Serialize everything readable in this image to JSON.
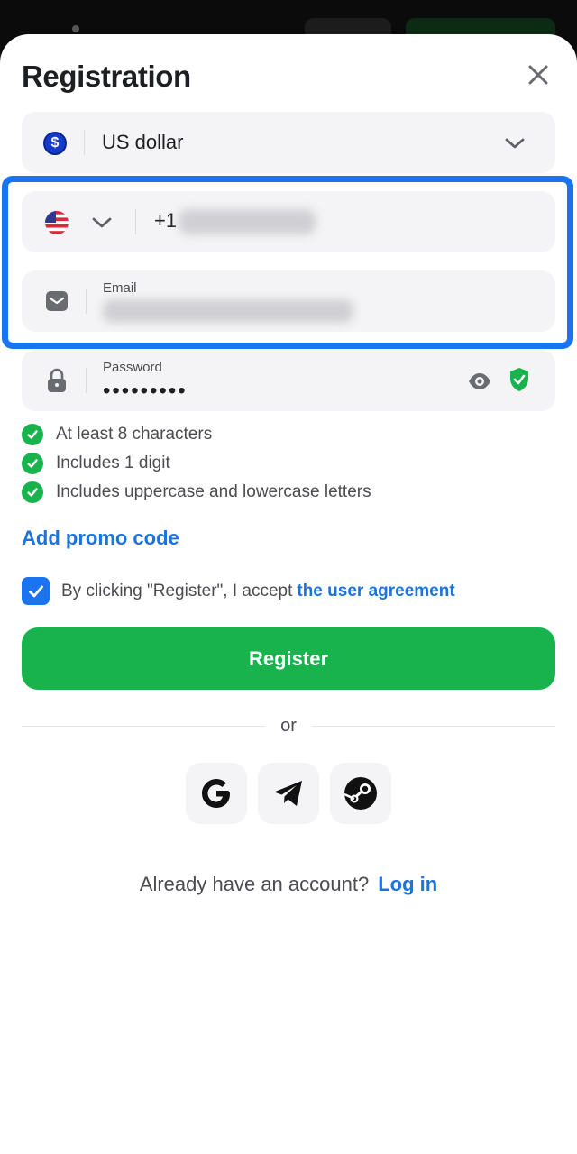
{
  "title": "Registration",
  "currency": {
    "value": "US dollar",
    "icon": "dollar-coin-icon",
    "symbol": "$"
  },
  "phone": {
    "country_icon": "us-flag-icon",
    "code": "+1"
  },
  "email": {
    "label": "Email"
  },
  "password": {
    "label": "Password",
    "masked_value": "•••••••••"
  },
  "rules": [
    {
      "text": "At least 8 characters"
    },
    {
      "text": "Includes 1 digit"
    },
    {
      "text": "Includes uppercase and lowercase letters"
    }
  ],
  "promo_label": "Add promo code",
  "agreement": {
    "text": "By clicking \"Register\", I accept",
    "link": "the user agreement",
    "checked": true
  },
  "register_label": "Register",
  "divider_label": "or",
  "social": [
    "google-icon",
    "telegram-icon",
    "steam-icon"
  ],
  "login": {
    "question": "Already have an account?",
    "link": "Log in"
  },
  "colors": {
    "accent": "#1a73e0",
    "brand_green": "#18b34d",
    "field_bg": "#f4f4f6",
    "highlight": "#1a73f0"
  }
}
